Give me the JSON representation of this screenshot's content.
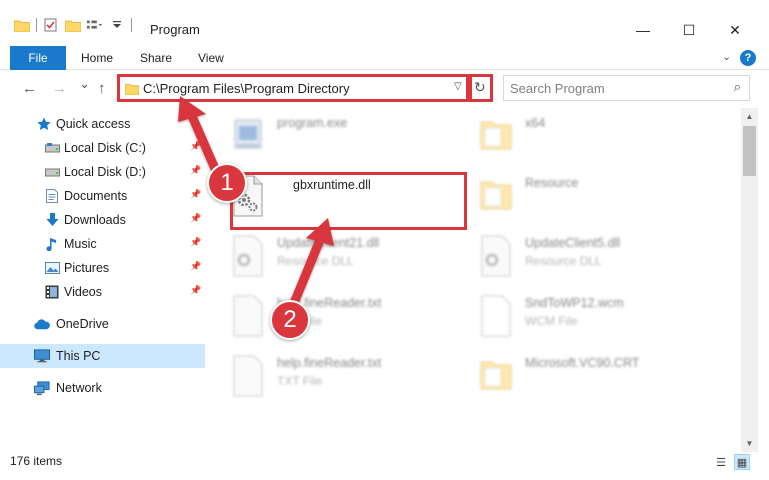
{
  "window": {
    "title": "Program",
    "controls": {
      "minimize": "—",
      "maximize": "☐",
      "close": "✕"
    }
  },
  "ribbon": {
    "tabs": [
      "File",
      "Home",
      "Share",
      "View"
    ],
    "expand_icon": "chevron-down-icon",
    "help_label": "?"
  },
  "navigation": {
    "back_icon": "←",
    "forward_icon": "→",
    "recent_icon": "⌄",
    "up_icon": "↑"
  },
  "address_bar": {
    "path": "C:\\Program Files\\Program Directory"
  },
  "search": {
    "placeholder": "Search Program"
  },
  "sidebar": {
    "items": [
      {
        "label": "Quick access",
        "icon": "star-icon",
        "pinned": false
      },
      {
        "label": "Local Disk (C:)",
        "icon": "drive-icon",
        "pinned": true
      },
      {
        "label": "Local Disk (D:)",
        "icon": "drive-icon",
        "pinned": true
      },
      {
        "label": "Documents",
        "icon": "documents-icon",
        "pinned": true
      },
      {
        "label": "Downloads",
        "icon": "downloads-icon",
        "pinned": true
      },
      {
        "label": "Music",
        "icon": "music-icon",
        "pinned": true
      },
      {
        "label": "Pictures",
        "icon": "pictures-icon",
        "pinned": true
      },
      {
        "label": "Videos",
        "icon": "videos-icon",
        "pinned": true
      },
      {
        "label": "OneDrive",
        "icon": "cloud-icon",
        "pinned": false
      },
      {
        "label": "This PC",
        "icon": "computer-icon",
        "pinned": false,
        "selected": true
      },
      {
        "label": "Network",
        "icon": "network-icon",
        "pinned": false
      }
    ]
  },
  "files": [
    {
      "name": "program.exe",
      "type": "",
      "icon": "application-icon"
    },
    {
      "name": "x64",
      "type": "",
      "icon": "folder-icon"
    },
    {
      "name": "gbxruntime.dll",
      "type": "",
      "icon": "dll-gear-icon",
      "highlighted": true
    },
    {
      "name": "Resource",
      "type": "",
      "icon": "folder-icon"
    },
    {
      "name": "UpdateClient21.dll",
      "type": "Resource DLL",
      "icon": "dll-gear-icon"
    },
    {
      "name": "UpdateClient5.dll",
      "type": "Resource DLL",
      "icon": "dll-gear-icon"
    },
    {
      "name": "help.fineReader.txt",
      "type": "TXT File",
      "icon": "text-file-icon"
    },
    {
      "name": "SndToWP12.wcm",
      "type": "WCM File",
      "icon": "blank-file-icon"
    },
    {
      "name": "help.fineReader.txt",
      "type": "TXT File",
      "icon": "text-file-icon"
    },
    {
      "name": "Microsoft.VC90.CRT",
      "type": "",
      "icon": "folder-icon"
    }
  ],
  "status": {
    "item_count": "176 items"
  },
  "annotations": {
    "step1": "1",
    "step2": "2",
    "color": "#d9363e"
  }
}
